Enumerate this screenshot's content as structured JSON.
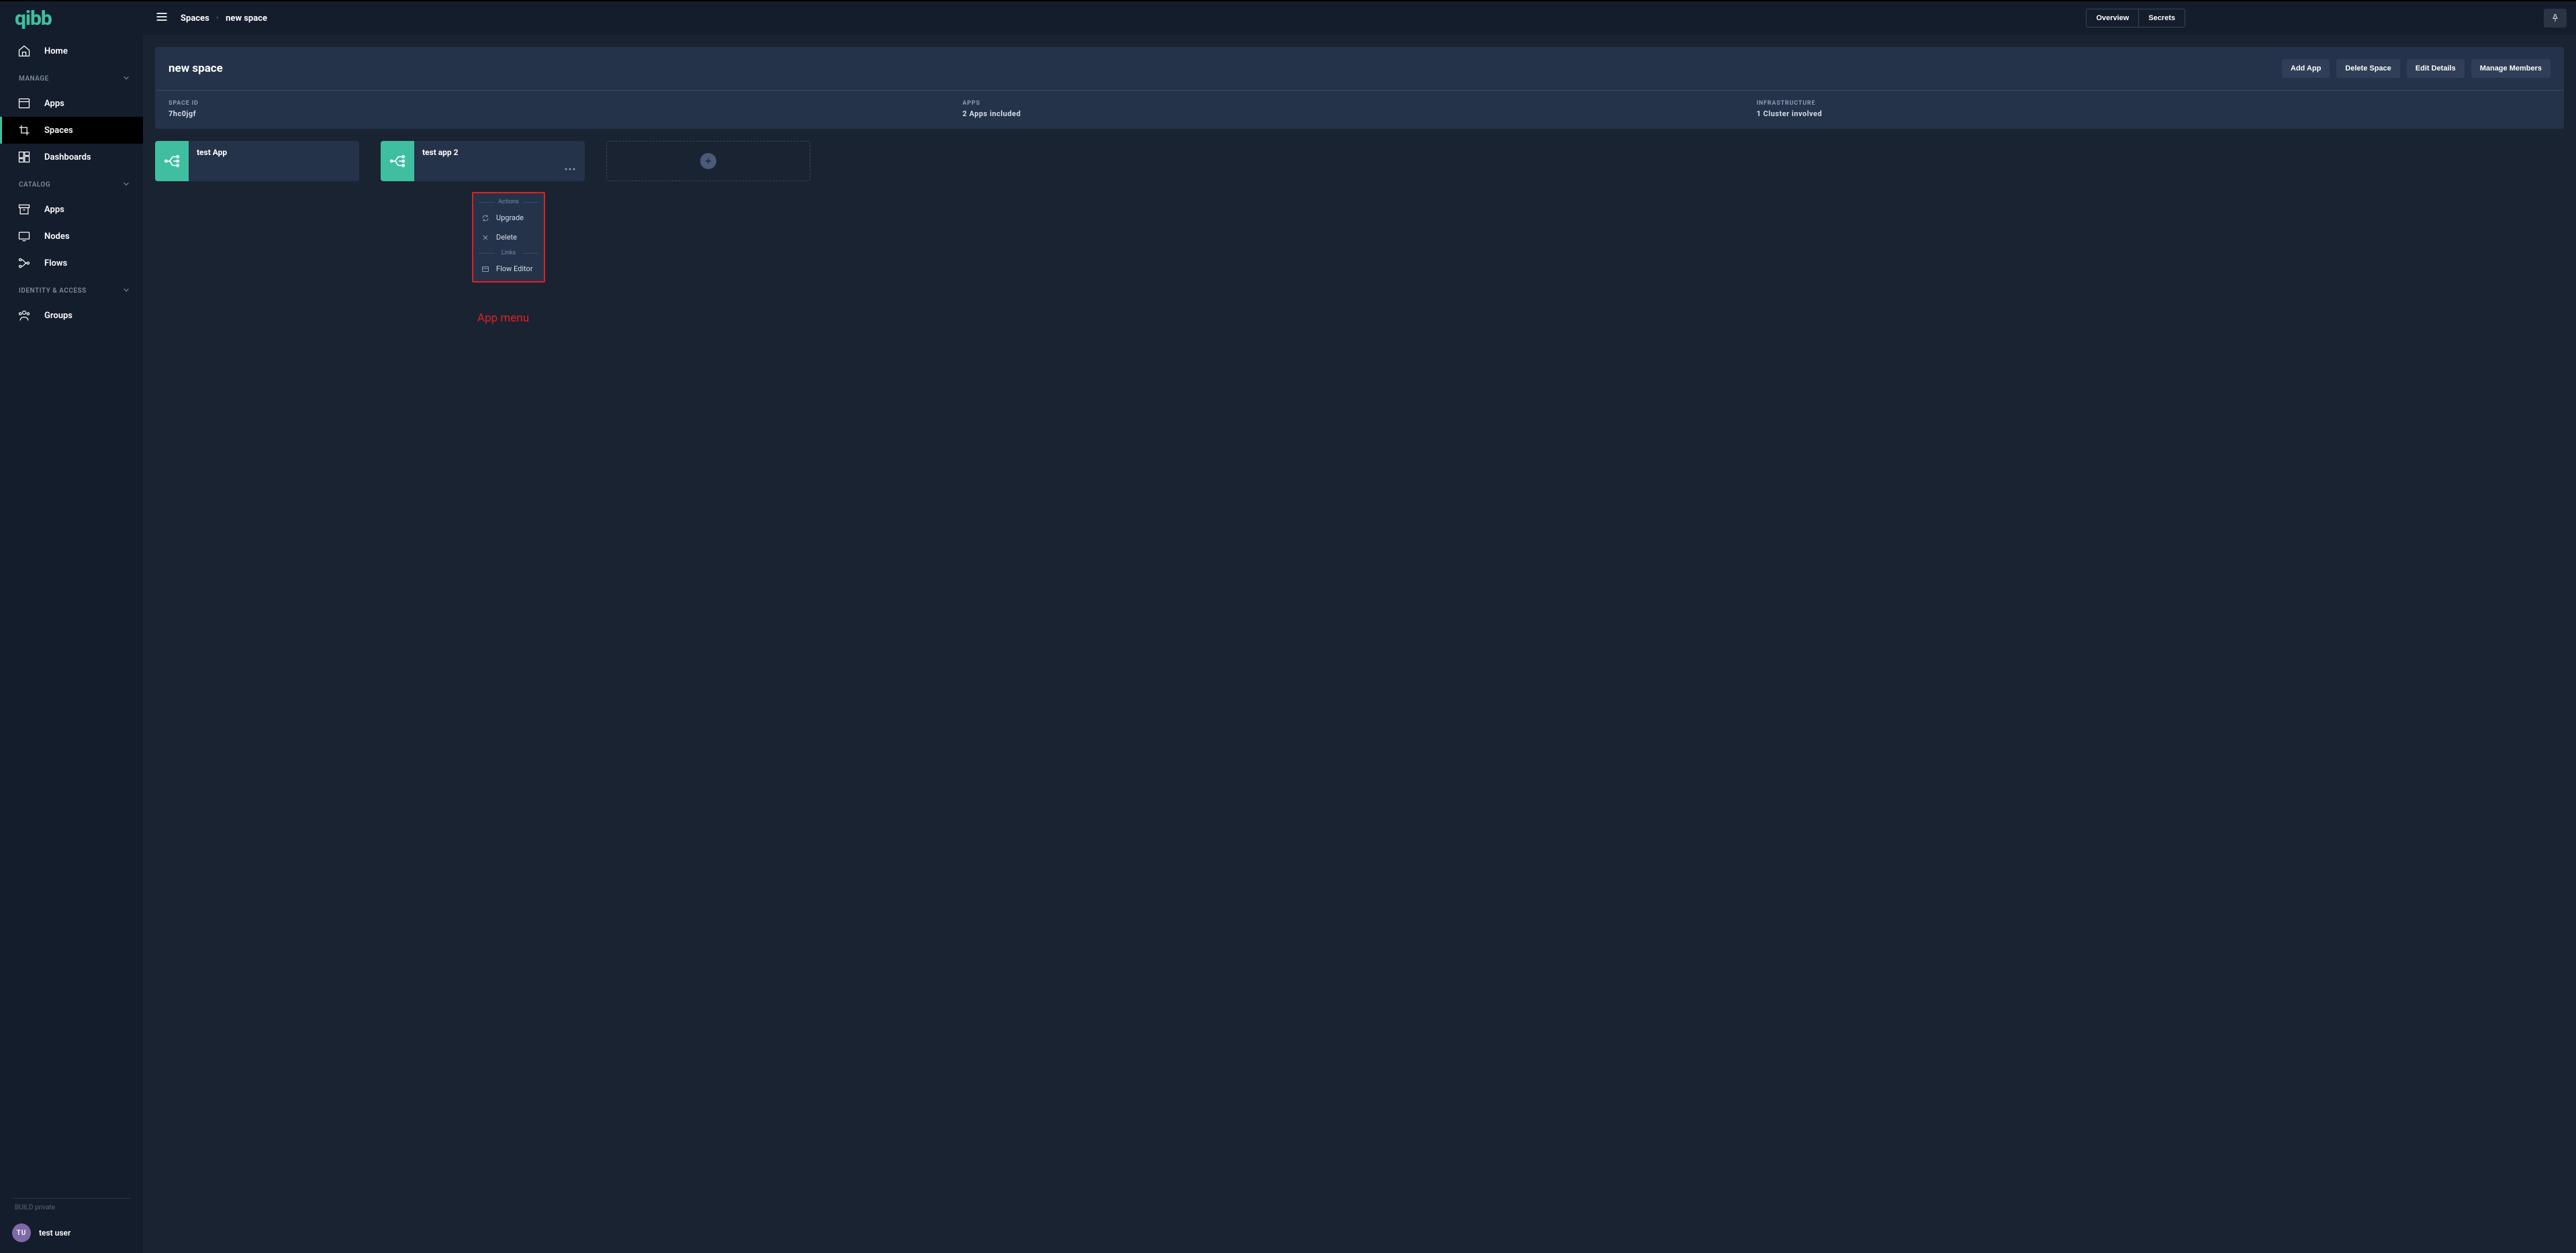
{
  "brand": "qibb",
  "sidebar": {
    "home": "Home",
    "sections": {
      "manage": "MANAGE",
      "catalog": "CATALOG",
      "identity": "IDENTITY & ACCESS"
    },
    "items": {
      "apps_manage": "Apps",
      "spaces": "Spaces",
      "dashboards": "Dashboards",
      "apps_catalog": "Apps",
      "nodes": "Nodes",
      "flows": "Flows",
      "groups": "Groups"
    },
    "build_label": "BUILD private",
    "user": {
      "initials": "TU",
      "name": "test user"
    }
  },
  "topbar": {
    "breadcrumb": {
      "root": "Spaces",
      "current": "new space"
    },
    "tabs": {
      "overview": "Overview",
      "secrets": "Secrets"
    }
  },
  "header": {
    "title": "new space",
    "actions": {
      "add_app": "Add App",
      "delete_space": "Delete Space",
      "edit_details": "Edit Details",
      "manage_members": "Manage Members"
    },
    "meta": {
      "space_id_label": "SPACE ID",
      "space_id_value": "7hc0jgf",
      "apps_label": "APPS",
      "apps_value": "2 Apps included",
      "infra_label": "INFRASTRUCTURE",
      "infra_value": "1 Cluster involved"
    }
  },
  "apps": [
    {
      "name": "test App"
    },
    {
      "name": "test app 2"
    }
  ],
  "context_menu": {
    "actions_label": "Actions",
    "upgrade": "Upgrade",
    "delete": "Delete",
    "links_label": "Links",
    "flow_editor": "Flow Editor"
  },
  "annotation": "App menu"
}
